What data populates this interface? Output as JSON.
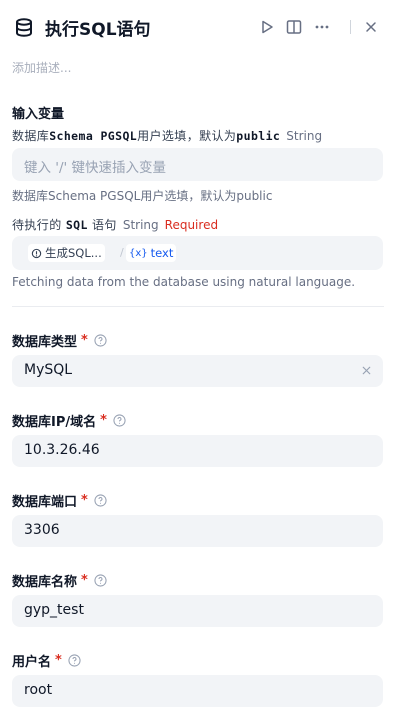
{
  "header": {
    "title": "执行SQL语句",
    "icons": [
      "database-logo-icon",
      "play-icon",
      "split-view-icon",
      "more-icon",
      "close-icon"
    ]
  },
  "description_placeholder": "添加描述...",
  "inputs": {
    "section_title": "输入变量",
    "var1": {
      "prefix": "数据库",
      "name": "Schema PGSQL",
      "middle": "用户选填，默认为",
      "code": "public",
      "type": "String",
      "input_placeholder": "键入 '/' 键快速插入变量",
      "hint": "数据库Schema PGSQL用户选填，默认为public"
    },
    "var2": {
      "prefix": "待执行的",
      "name": "SQL",
      "suffix": "语句",
      "type": "String",
      "required": "Required",
      "chip_generate": "生成SQL...",
      "chip_var_icon": "{x}",
      "chip_var": "text",
      "hint": "Fetching data from the database using natural language."
    }
  },
  "fields": [
    {
      "label": "数据库类型",
      "star": "*",
      "value": "MySQL"
    },
    {
      "label": "数据库IP/域名",
      "star": "*",
      "value": "10.3.26.46"
    },
    {
      "label": "数据库端口",
      "star": "*",
      "value": "3306"
    },
    {
      "label": "数据库名称",
      "star": "*",
      "value": "gyp_test"
    },
    {
      "label": "用户名",
      "star": "*",
      "value": "root"
    }
  ]
}
